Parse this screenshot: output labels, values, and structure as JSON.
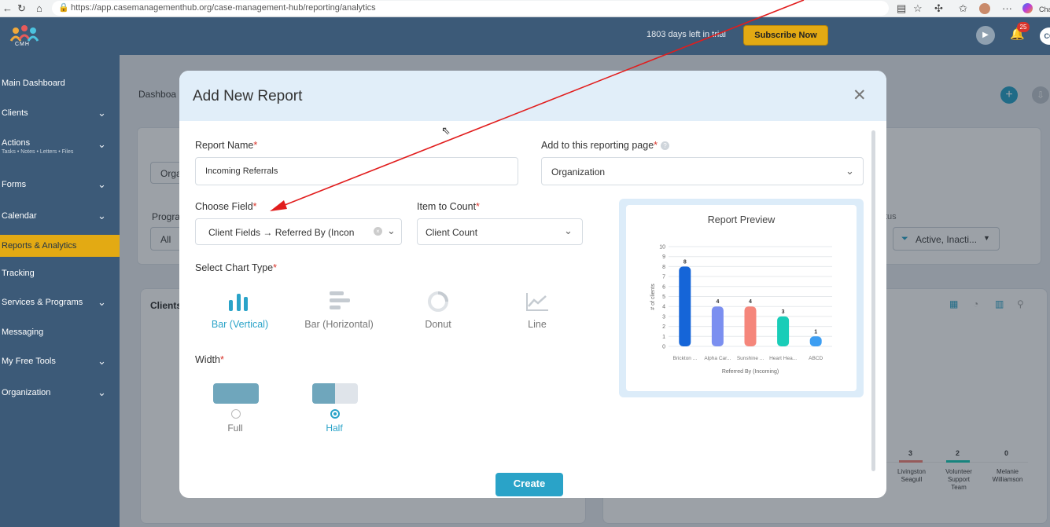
{
  "browser": {
    "url": "https://app.casemanagementhub.org/case-management-hub/reporting/analytics",
    "tab_label": "Cha"
  },
  "topbar": {
    "logo_text": "CMH",
    "trial_text": "1803 days left in trial",
    "subscribe_label": "Subscribe Now",
    "notification_count": "25",
    "avatar_initials": "CC"
  },
  "sidebar": {
    "items": [
      {
        "label": "Main Dashboard",
        "sub": "",
        "chevron": false,
        "active": false
      },
      {
        "label": "Clients",
        "sub": "",
        "chevron": true,
        "active": false
      },
      {
        "label": "Actions",
        "sub": "Tasks • Notes • Letters • Files",
        "chevron": true,
        "active": false
      },
      {
        "label": "Forms",
        "sub": "",
        "chevron": true,
        "active": false
      },
      {
        "label": "Calendar",
        "sub": "",
        "chevron": true,
        "active": false
      },
      {
        "label": "Reports & Analytics",
        "sub": "",
        "chevron": false,
        "active": true
      },
      {
        "label": "Tracking",
        "sub": "",
        "chevron": false,
        "active": false
      },
      {
        "label": "Services & Programs",
        "sub": "",
        "chevron": true,
        "active": false
      },
      {
        "label": "Messaging",
        "sub": "",
        "chevron": false,
        "active": false
      },
      {
        "label": "My Free Tools",
        "sub": "",
        "chevron": true,
        "active": false
      },
      {
        "label": "Organization",
        "sub": "",
        "chevron": true,
        "active": false
      }
    ]
  },
  "background": {
    "breadcrumb": "Dashboa",
    "filter_org": "Orga",
    "program_label": "Progra",
    "program_value": "All",
    "status_label": "tus",
    "status_value": "Active, Inacti...",
    "clients_card_title": "Clients",
    "bg_bars": [
      {
        "label": "Livingston Seagull",
        "value": "3"
      },
      {
        "label": "Volunteer Support Team",
        "value": "2"
      },
      {
        "label": "Melanie Williamson",
        "value": "0"
      }
    ]
  },
  "modal": {
    "title": "Add New Report",
    "report_name_label": "Report Name",
    "report_name_value": "Incoming Referrals",
    "page_label": "Add to this reporting page",
    "page_value": "Organization",
    "choose_field_label": "Choose Field",
    "choose_field_value": "Client Fields → Referred By (Incon",
    "item_count_label": "Item to Count",
    "item_count_value": "Client Count",
    "chart_type_label": "Select Chart Type",
    "chart_types": [
      {
        "name": "Bar (Vertical)",
        "icon": "bar-vertical-icon",
        "selected": true
      },
      {
        "name": "Bar (Horizontal)",
        "icon": "bar-horizontal-icon",
        "selected": false
      },
      {
        "name": "Donut",
        "icon": "donut-icon",
        "selected": false
      },
      {
        "name": "Line",
        "icon": "line-chart-icon",
        "selected": false
      }
    ],
    "width_label": "Width",
    "width_options": [
      {
        "name": "Full",
        "selected": false
      },
      {
        "name": "Half",
        "selected": true
      }
    ],
    "preview_title": "Report Preview",
    "create_label": "Create"
  },
  "chart_data": {
    "type": "bar",
    "title": "",
    "categories": [
      "Brickton ...",
      "Alpha Car...",
      "Sunshine ...",
      "Heart Hea...",
      "ABCD"
    ],
    "values": [
      8,
      4,
      4,
      3,
      1
    ],
    "colors": [
      "#1565d8",
      "#7b8ff0",
      "#f5867b",
      "#19cdb8",
      "#3d9ef2"
    ],
    "ylabel": "# of clients",
    "xlabel": "Referred By (Incoming)",
    "ylim": [
      0,
      10
    ],
    "yticks": [
      0,
      1,
      2,
      3,
      4,
      5,
      6,
      7,
      8,
      9,
      10
    ],
    "grid": true
  },
  "colors": {
    "sidebar": "#3c5a78",
    "accent": "#2aa3c8",
    "active_nav": "#e3aa13",
    "annotation_arrow": "#e11d1d"
  }
}
